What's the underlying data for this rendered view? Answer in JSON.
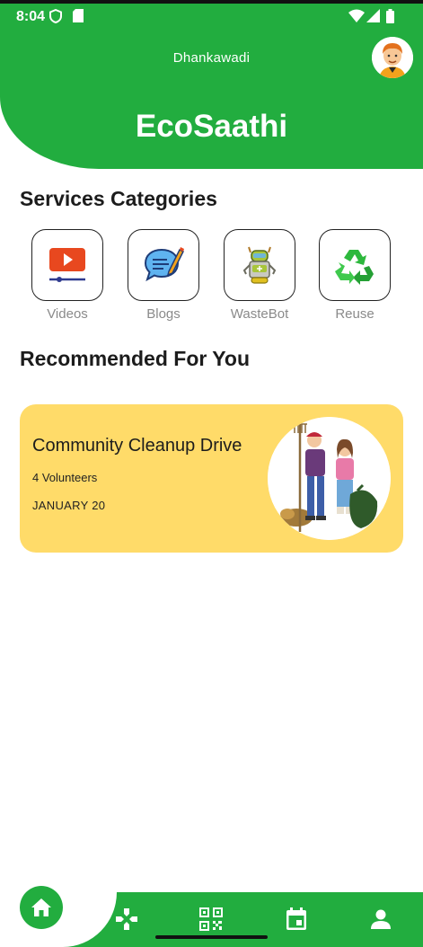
{
  "status_bar": {
    "time": "8:04"
  },
  "header": {
    "location": "Dhankawadi",
    "app_title": "EcoSaathi"
  },
  "services": {
    "title": "Services Categories",
    "items": [
      {
        "label": "Videos",
        "icon": "video-play-icon"
      },
      {
        "label": "Blogs",
        "icon": "blog-chat-icon"
      },
      {
        "label": "WasteBot",
        "icon": "robot-icon"
      },
      {
        "label": "Reuse",
        "icon": "recycle-icon"
      }
    ]
  },
  "recommended": {
    "title": "Recommended For You",
    "card": {
      "title": "Community Cleanup Drive",
      "volunteers": "4 Volunteers",
      "date": "JANUARY 20"
    }
  },
  "bottom_nav": {
    "items": [
      "home-icon",
      "gamepad-icon",
      "qr-code-icon",
      "calendar-icon",
      "profile-icon"
    ]
  },
  "colors": {
    "primary": "#22ad3f",
    "card": "#ffdb69",
    "text": "#1c1c1c",
    "muted": "#8a8a8a"
  }
}
